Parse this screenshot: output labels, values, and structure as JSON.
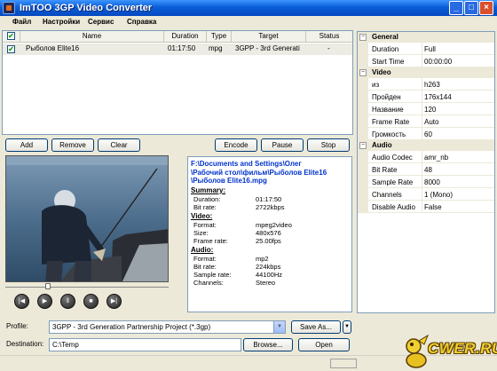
{
  "window": {
    "title": "ImTOO 3GP Video Converter"
  },
  "menu": [
    "Файл",
    "Настройки",
    "Сервис",
    "Справка"
  ],
  "file_list": {
    "columns": [
      "Name",
      "Duration",
      "Type",
      "Target",
      "Status"
    ],
    "rows": [
      {
        "checked": true,
        "name": "Рыболов Elite16",
        "duration": "01:17:50",
        "type": "mpg",
        "target": "3GPP - 3rd Generati",
        "status": "-"
      }
    ]
  },
  "list_buttons": {
    "add": "Add",
    "remove": "Remove",
    "clear": "Clear",
    "encode": "Encode",
    "pause": "Pause",
    "stop": "Stop"
  },
  "player": {
    "seek_fraction": 0.25
  },
  "info": {
    "path_lines": [
      "F:\\Documents and Settings\\Олег",
      "\\Рабочий стол\\фильм\\Рыболов Elite16",
      "\\Рыболов Elite16.mpg"
    ],
    "sections": [
      {
        "title": "Summary:",
        "rows": [
          {
            "k": "Duration:",
            "v": "01:17:50"
          },
          {
            "k": "Bit rate:",
            "v": "2722kbps"
          }
        ]
      },
      {
        "title": "Video:",
        "rows": [
          {
            "k": "Format:",
            "v": "mpeg2video"
          },
          {
            "k": "Size:",
            "v": "480x576"
          },
          {
            "k": "Frame rate:",
            "v": "25.00fps"
          }
        ]
      },
      {
        "title": "Audio:",
        "rows": [
          {
            "k": "Format:",
            "v": "mp2"
          },
          {
            "k": "Bit rate:",
            "v": "224kbps"
          },
          {
            "k": "Sample rate:",
            "v": "44100Hz"
          },
          {
            "k": "Channels:",
            "v": "Stereo"
          }
        ]
      }
    ]
  },
  "profile": {
    "label": "Profile:",
    "value": "3GPP - 3rd Generation Partnership Project  (*.3gp)",
    "save_as": "Save As..."
  },
  "destination": {
    "label": "Destination:",
    "value": "C:\\Temp",
    "browse": "Browse...",
    "open": "Open"
  },
  "properties": {
    "general": {
      "title": "General",
      "rows": [
        {
          "k": "Duration",
          "v": "Full"
        },
        {
          "k": "Start Time",
          "v": "00:00:00"
        }
      ]
    },
    "video": {
      "title": "Video",
      "rows": [
        {
          "k": "из",
          "v": "h263"
        },
        {
          "k": "Пройден",
          "v": "176x144"
        },
        {
          "k": "Название",
          "v": "120"
        },
        {
          "k": "Frame Rate",
          "v": "Auto"
        },
        {
          "k": "Громкость",
          "v": "60"
        }
      ]
    },
    "audio": {
      "title": "Audio",
      "rows": [
        {
          "k": "Audio Codec",
          "v": "amr_nb"
        },
        {
          "k": "Bit Rate",
          "v": "48"
        },
        {
          "k": "Sample Rate",
          "v": "8000"
        },
        {
          "k": "Channels",
          "v": "1 (Mono)"
        },
        {
          "k": "Disable Audio",
          "v": "False"
        }
      ]
    }
  },
  "watermark": {
    "text": "CWER.RU"
  },
  "colors": {
    "titlebar": "#0a5fd8",
    "path_text": "#0033cc",
    "window_bg": "#ece9d8"
  }
}
